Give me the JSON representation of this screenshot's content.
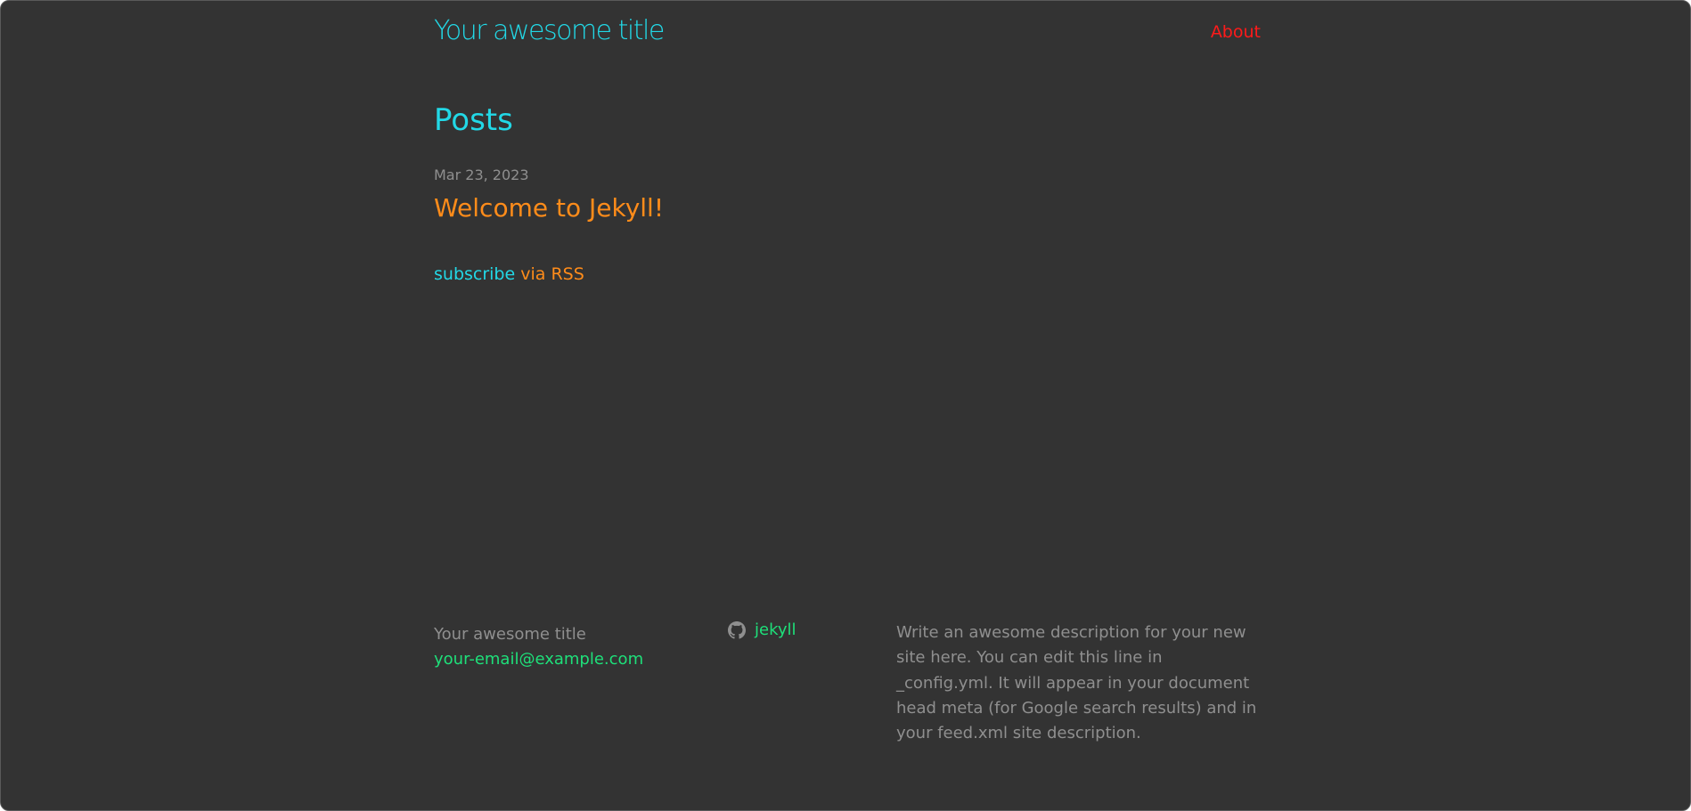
{
  "header": {
    "site_title": "Your awesome title",
    "nav": [
      {
        "label": "About"
      }
    ]
  },
  "main": {
    "heading": "Posts",
    "posts": [
      {
        "date": "Mar 23, 2023",
        "title": "Welcome to Jekyll!"
      }
    ],
    "rss": {
      "subscribe": "subscribe",
      "via": "via RSS"
    }
  },
  "footer": {
    "name": "Your awesome title",
    "email": "your-email@example.com",
    "github_icon": "github-icon",
    "github_user": "jekyll",
    "description": "Write an awesome description for your new site here. You can edit this line in _config.yml. It will appear in your document head meta (for Google search results) and in your feed.xml site description."
  },
  "colors": {
    "background": "#333333",
    "accent_cyan": "#22d8e6",
    "accent_orange": "#ff8c1a",
    "accent_red": "#ff1a1a",
    "accent_green": "#1ee07a",
    "muted": "#8f8f8f"
  }
}
